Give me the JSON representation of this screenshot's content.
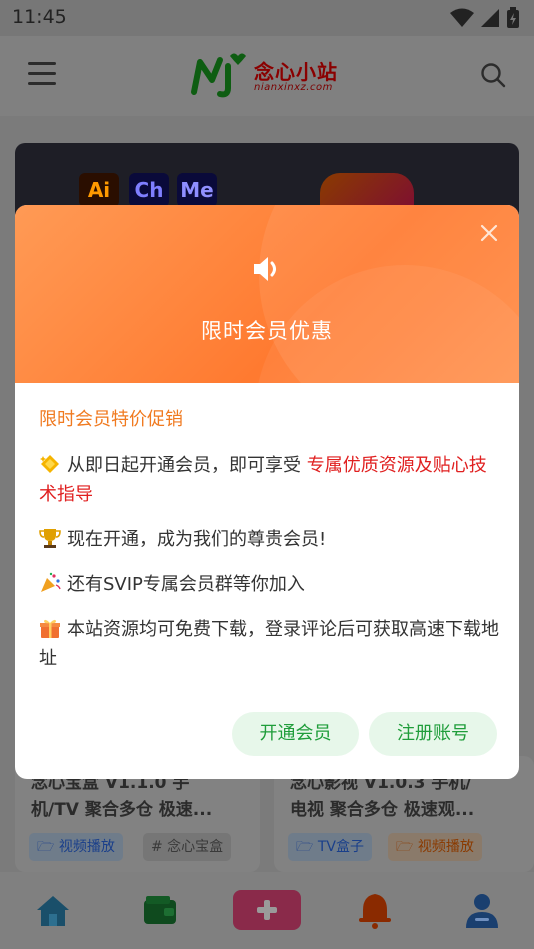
{
  "status_bar": {
    "time": "11:45"
  },
  "app_bar": {
    "logo_text": "念心小站",
    "logo_sub": "nianxinxz.com"
  },
  "cards": [
    {
      "badges": [
        "Ai",
        "Ch",
        "Me"
      ],
      "title_line1": "念心宝盒 V1.1.0 手",
      "title_line2": "机/TV 聚合多仓 极速...",
      "tags": [
        "视频播放",
        "# 念心宝盒"
      ]
    },
    {
      "title_line1": "念心影视 V1.0.3 手机/",
      "title_line2": "电视 聚合多仓 极速观...",
      "tags": [
        "TV盒子",
        "视频播放"
      ]
    }
  ],
  "dialog": {
    "title": "限时会员优惠",
    "promo_heading": "限时会员特价促销",
    "line1_text": "从即日起开通会员，即可享受 ",
    "line1_highlight": "专属优质资源及贴心技术指导",
    "line2": "现在开通，成为我们的尊贵会员!",
    "line3": "还有SVIP专属会员群等你加入",
    "line4": "本站资源均可免费下载，登录评论后可获取高速下载地址",
    "primary_button": "开通会员",
    "secondary_button": "注册账号"
  },
  "colors": {
    "header_orange": "#ff7a30",
    "heading_orange": "#f07a20",
    "highlight_red": "#e02020",
    "button_green": "#1f9d3a",
    "button_bg": "#e7f7ea"
  }
}
